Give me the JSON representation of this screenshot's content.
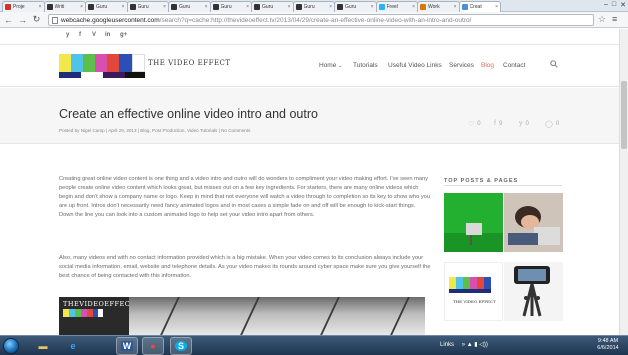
{
  "browser": {
    "tabs": [
      {
        "title": "Proje",
        "favicon": "gmail",
        "active": false
      },
      {
        "title": "Writi",
        "favicon": "cache",
        "active": false
      },
      {
        "title": "Guru",
        "favicon": "cache",
        "active": false
      },
      {
        "title": "Guru",
        "favicon": "cache",
        "active": false
      },
      {
        "title": "Guru",
        "favicon": "cache",
        "active": false
      },
      {
        "title": "Guru",
        "favicon": "cache",
        "active": false
      },
      {
        "title": "Guru",
        "favicon": "cache",
        "active": false
      },
      {
        "title": "Guru",
        "favicon": "cache",
        "active": false
      },
      {
        "title": "Guru",
        "favicon": "cache",
        "active": false
      },
      {
        "title": "Freel",
        "favicon": "freelancer",
        "active": false
      },
      {
        "title": "Work",
        "favicon": "work",
        "active": false
      },
      {
        "title": "Creat",
        "favicon": "page",
        "active": true
      }
    ],
    "address": {
      "host": "webcache.googleusercontent.com",
      "path": "/search?q=cache:http://thevideoeffect.tv/2013/04/29/create-an-effective-online-video-with-an-intro-and-outro/"
    }
  },
  "site": {
    "social_icons": [
      "twitter-icon",
      "facebook-icon",
      "vimeo-icon",
      "linkedin-icon",
      "googleplus-icon"
    ],
    "social_glyphs": [
      "y",
      "f",
      "V",
      "in",
      "g+"
    ],
    "logo_text": "THE VIDEO EFFECT",
    "nav": [
      {
        "label": "Home",
        "dropdown": true,
        "active": false
      },
      {
        "label": "Tutorials",
        "active": false
      },
      {
        "label": "Useful Video Links",
        "active": false
      },
      {
        "label": "Services",
        "active": false
      },
      {
        "label": "Blog",
        "active": true
      },
      {
        "label": "Contact",
        "active": false
      }
    ],
    "accent_color": "#e26a5a"
  },
  "post": {
    "title": "Create an effective online video intro and outro",
    "meta": "Posted by Nigel Camp | April 29, 2013 | Blog, Post Production, Video Tutorials | No Comments",
    "counters": [
      {
        "icon": "heart-icon",
        "glyph": "♡",
        "value": "0"
      },
      {
        "icon": "facebook-share-icon",
        "glyph": "f",
        "value": "9"
      },
      {
        "icon": "twitter-share-icon",
        "glyph": "y",
        "value": "0"
      },
      {
        "icon": "comment-icon",
        "glyph": "◯",
        "value": "0"
      }
    ],
    "paragraphs": [
      "Creating great online video content is one thing and a video intro and outro will do wonders to compliment your video making effort. I've seen many people create online video content which looks great, but misses out on a few key ingredients. For starters, there are many online videos which begin and don't show a company name or logo. Keep in mind that not everyone will watch a video through to completion so its key to show who you are up front. Intros don't necessarily need fancy animated logos and in most cases a simple fade on and off will be enough to kick-start things. Down the line you can look into a custom animated logo to help set your video intro apart from others.",
      "Also, many videos end with no contact information provided which is a big mistake. When your video comes to its conclusion always include your social media information, email, website and telephone details. As your video makes its rounds around cyber space make sure you give yourself the best chance of being contacted with this information."
    ],
    "video_brand": "THEVIDEOEFFECT.TV"
  },
  "sidebar": {
    "heading": "TOP POSTS & PAGES",
    "thumbs": [
      {
        "name": "thumb-green-screen"
      },
      {
        "name": "thumb-sleeping-laptop"
      },
      {
        "name": "thumb-video-effect-logo",
        "caption": "THE VIDEO EFFECT"
      },
      {
        "name": "thumb-iphone-tripod"
      }
    ]
  },
  "taskbar": {
    "apps": [
      {
        "name": "explorer-icon",
        "glyph": "▬",
        "color": "#e8c55a"
      },
      {
        "name": "internet-explorer-icon",
        "glyph": "e",
        "color": "#3aa0ff"
      },
      {
        "name": "word-icon",
        "glyph": "W",
        "color": "#2b5797"
      },
      {
        "name": "chrome-icon",
        "glyph": "●",
        "color": "#e74c3c"
      },
      {
        "name": "skype-icon",
        "glyph": "S",
        "color": "#00aff0"
      }
    ],
    "tray_label": "Links",
    "time": "9:48 AM",
    "date": "6/6/2014"
  }
}
